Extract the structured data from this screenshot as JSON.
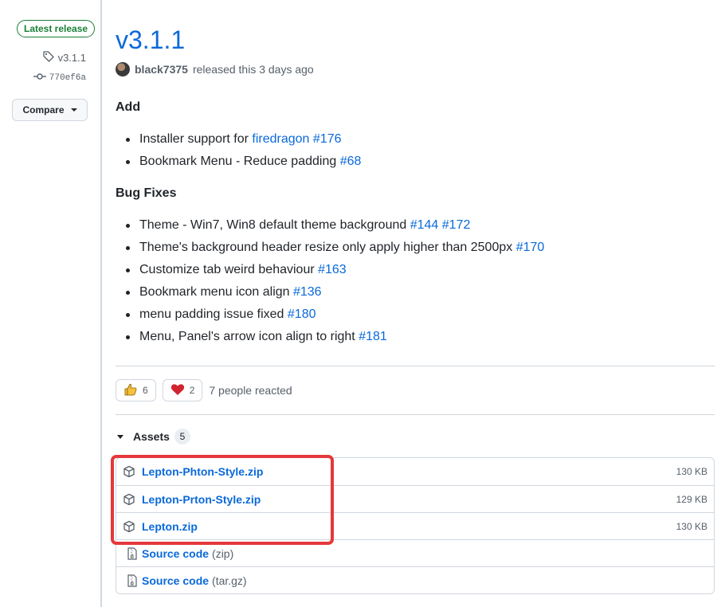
{
  "sidebar": {
    "latest_badge": "Latest release",
    "tag": "v3.1.1",
    "commit": "770ef6a",
    "compare_label": "Compare"
  },
  "release": {
    "title": "v3.1.1",
    "author": "black7375",
    "released_text": "released this 3 days ago"
  },
  "sections": {
    "add_title": "Add",
    "add_items": [
      {
        "text": "Installer support for ",
        "links": [
          "firedragon",
          "#176"
        ]
      },
      {
        "text": "Bookmark Menu - Reduce padding ",
        "links": [
          "#68"
        ]
      }
    ],
    "bugfix_title": "Bug Fixes",
    "bugfix_items": [
      {
        "text": "Theme - Win7, Win8 default theme background ",
        "links": [
          "#144",
          "#172"
        ]
      },
      {
        "text": "Theme's background header resize only apply higher than 2500px ",
        "links": [
          "#170"
        ]
      },
      {
        "text": "Customize tab weird behaviour ",
        "links": [
          "#163"
        ]
      },
      {
        "text": "Bookmark menu icon align ",
        "links": [
          "#136"
        ]
      },
      {
        "text": "menu padding issue fixed ",
        "links": [
          "#180"
        ]
      },
      {
        "text": "Menu, Panel's arrow icon align to right ",
        "links": [
          "#181"
        ]
      }
    ]
  },
  "reactions": {
    "thumbs_up_count": "6",
    "heart_count": "2",
    "summary": "7 people reacted"
  },
  "assets": {
    "label": "Assets",
    "count": "5",
    "items": [
      {
        "name": "Lepton-Phton-Style.zip",
        "suffix": "",
        "size": "130 KB",
        "icon": "package-icon"
      },
      {
        "name": "Lepton-Prton-Style.zip",
        "suffix": "",
        "size": "129 KB",
        "icon": "package-icon"
      },
      {
        "name": "Lepton.zip",
        "suffix": "",
        "size": "130 KB",
        "icon": "package-icon"
      },
      {
        "name": "Source code",
        "suffix": "(zip)",
        "size": "",
        "icon": "file-zip-icon"
      },
      {
        "name": "Source code",
        "suffix": "(tar.gz)",
        "size": "",
        "icon": "file-zip-icon"
      }
    ]
  },
  "colors": {
    "link": "#0969da",
    "badge_green": "#1a7f37",
    "highlight_red": "#e5383b"
  }
}
